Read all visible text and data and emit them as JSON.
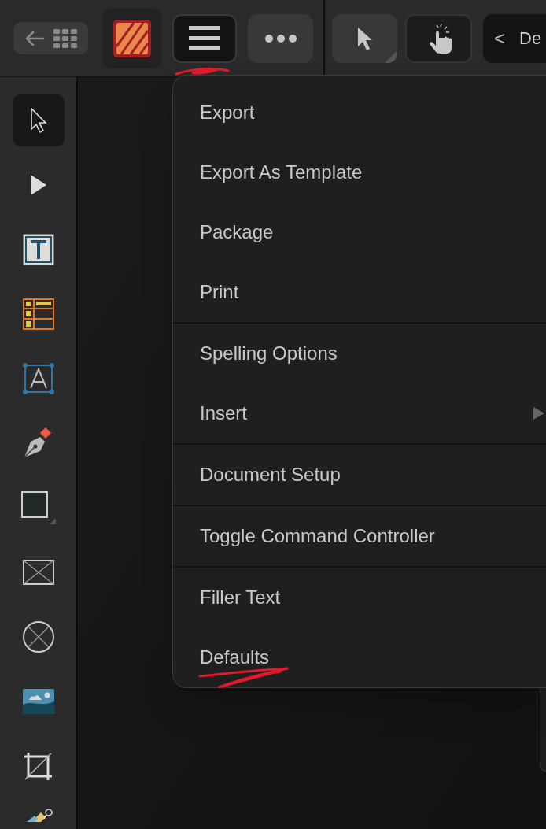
{
  "top_bar": {
    "menu_button": {
      "selected": true
    },
    "breadcrumb": {
      "chevron": "<",
      "label": "De"
    }
  },
  "tools": [
    {
      "kind": "select",
      "selected": true
    },
    {
      "kind": "node",
      "selected": false
    },
    {
      "kind": "frame_text",
      "selected": false
    },
    {
      "kind": "table",
      "selected": false
    },
    {
      "kind": "artistic_text",
      "selected": false
    },
    {
      "kind": "pen",
      "selected": false
    },
    {
      "kind": "rectangle",
      "selected": false
    },
    {
      "kind": "picture_frame",
      "selected": false
    },
    {
      "kind": "ellipse_frame",
      "selected": false
    },
    {
      "kind": "image",
      "selected": false
    },
    {
      "kind": "crop",
      "selected": false
    },
    {
      "kind": "fill",
      "selected": false
    }
  ],
  "menu": {
    "sections": [
      [
        {
          "label": "Export",
          "kind": "plain"
        },
        {
          "label": "Export As Template",
          "kind": "plain"
        },
        {
          "label": "Package",
          "kind": "plain"
        },
        {
          "label": "Print",
          "kind": "plain"
        }
      ],
      [
        {
          "label": "Spelling Options",
          "kind": "plain"
        },
        {
          "label": "Insert",
          "kind": "submenu"
        }
      ],
      [
        {
          "label": "Document Setup",
          "kind": "plain"
        }
      ],
      [
        {
          "label": "Toggle Command Controller",
          "kind": "plain"
        }
      ],
      [
        {
          "label": "Filler Text",
          "kind": "plain"
        },
        {
          "label": "Defaults",
          "kind": "plain"
        }
      ]
    ]
  }
}
